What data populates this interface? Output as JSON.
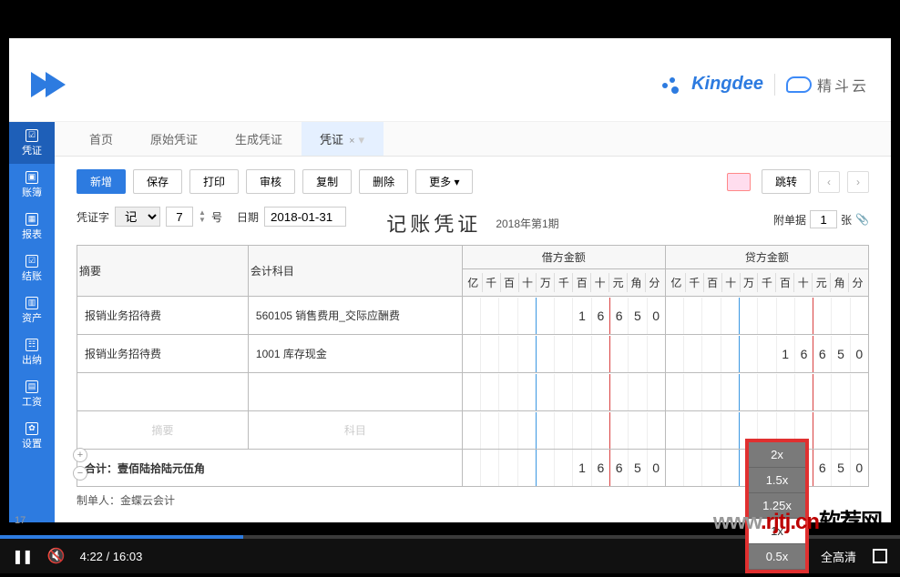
{
  "header": {
    "kingdee": "Kingdee",
    "jdy": "精斗云"
  },
  "sidebar": {
    "items": [
      {
        "label": "凭证",
        "icon": "☑"
      },
      {
        "label": "账簿",
        "icon": "▣"
      },
      {
        "label": "报表",
        "icon": "▦"
      },
      {
        "label": "结账",
        "icon": "☑"
      },
      {
        "label": "资产",
        "icon": "▥"
      },
      {
        "label": "出纳",
        "icon": "☷"
      },
      {
        "label": "工资",
        "icon": "▤"
      },
      {
        "label": "设置",
        "icon": "✿"
      }
    ]
  },
  "tabs": [
    {
      "label": "首页"
    },
    {
      "label": "原始凭证"
    },
    {
      "label": "生成凭证"
    },
    {
      "label": "凭证",
      "active": true,
      "closable": true
    }
  ],
  "toolbar": {
    "new": "新增",
    "save": "保存",
    "print": "打印",
    "audit": "审核",
    "copy": "复制",
    "delete": "删除",
    "more": "更多",
    "jump": "跳转"
  },
  "voucher": {
    "word_label": "凭证字",
    "word_value": "记",
    "number": "7",
    "number_suffix": "号",
    "date_label": "日期",
    "date_value": "2018-01-31",
    "title": "记账凭证",
    "period": "2018年第1期",
    "attach_label": "附单据",
    "attach_count": "1",
    "attach_unit": "张"
  },
  "table": {
    "headers": {
      "summary": "摘要",
      "subject": "会计科目",
      "debit": "借方金额",
      "credit": "贷方金额",
      "digits": [
        "亿",
        "千",
        "百",
        "十",
        "万",
        "千",
        "百",
        "十",
        "元",
        "角",
        "分"
      ]
    },
    "rows": [
      {
        "summary": "报销业务招待费",
        "subject": "560105 销售费用_交际应酬费",
        "debit": "16650",
        "credit": ""
      },
      {
        "summary": "报销业务招待费",
        "subject": "1001 库存现金",
        "debit": "",
        "credit": "16650"
      }
    ],
    "placeholder": {
      "summary": "摘要",
      "subject": "科目"
    },
    "total_label": "合计：壹佰陆拾陆元伍角",
    "total_debit": "16650",
    "total_credit": "16650"
  },
  "footer": {
    "maker_label": "制单人：",
    "maker": "金蝶云会计"
  },
  "speed_menu": [
    "2x",
    "1.5x",
    "1.25x",
    "1x",
    "0.5x"
  ],
  "watermark": {
    "pre": "www",
    "mid": ".rjtj.cn",
    "suf": "软荐网"
  },
  "slide_page": "17",
  "player": {
    "current": "4:22",
    "total": "16:03",
    "speed": "1x",
    "quality": "全高清",
    "progress_percent": 27
  }
}
